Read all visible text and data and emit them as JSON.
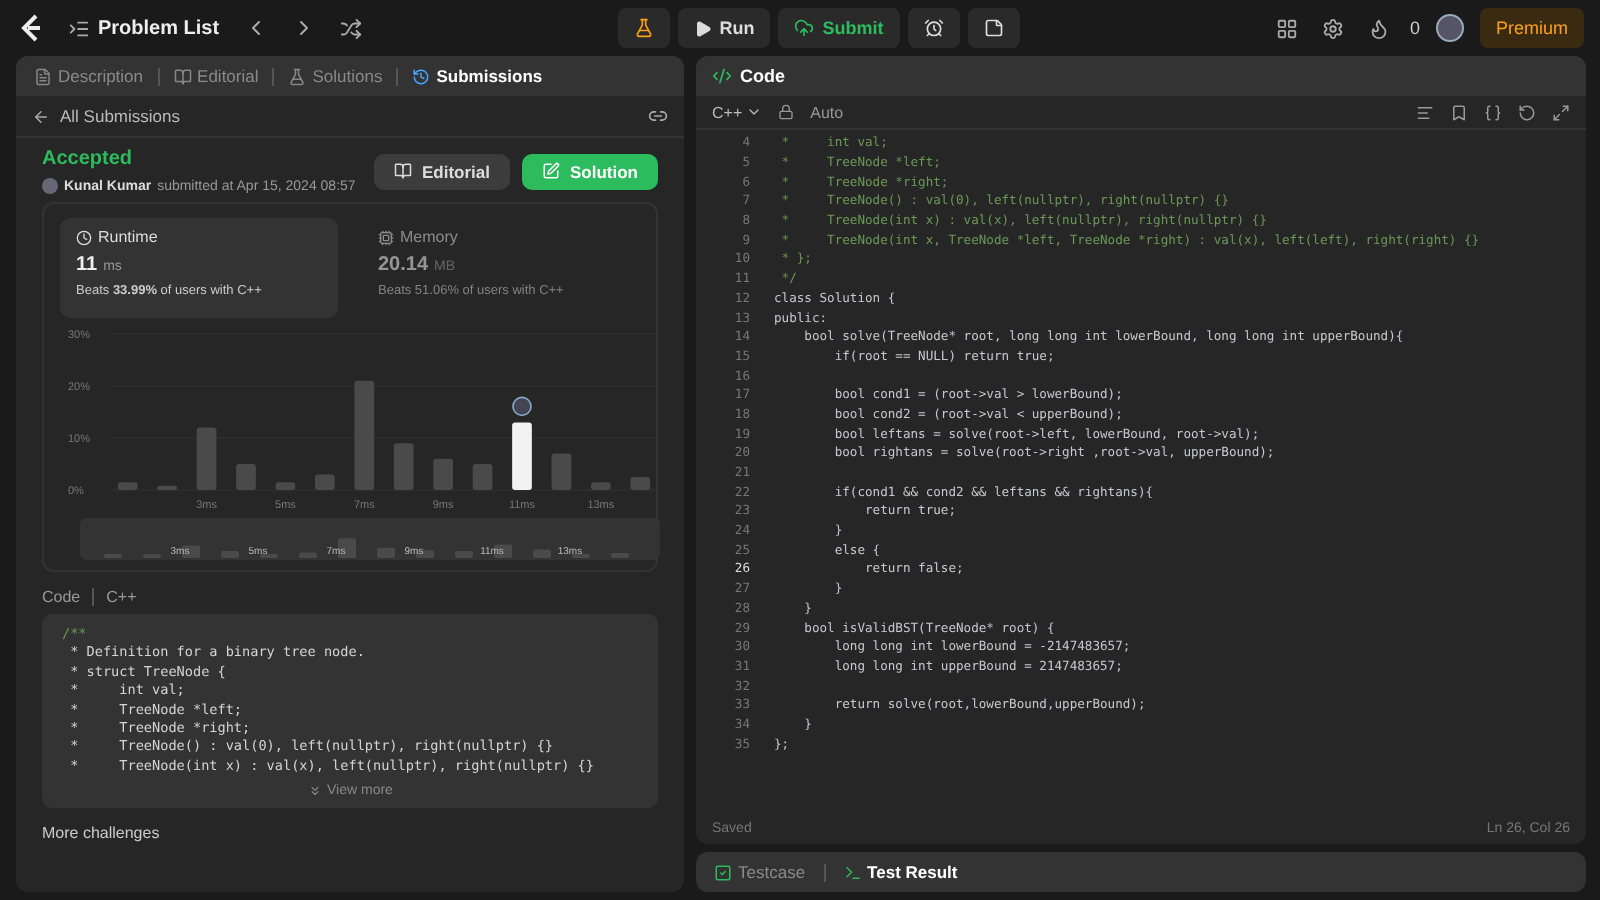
{
  "topbar": {
    "problem_list": "Problem List",
    "run": "Run",
    "submit": "Submit",
    "streak": "0",
    "premium": "Premium"
  },
  "left_tabs": [
    {
      "label": "Description",
      "selected": false
    },
    {
      "label": "Editorial",
      "selected": false
    },
    {
      "label": "Solutions",
      "selected": false
    },
    {
      "label": "Submissions",
      "selected": true
    }
  ],
  "back_link": "All Submissions",
  "submission": {
    "status": "Accepted",
    "user": "Kunal Kumar",
    "submitted": "submitted at Apr 15, 2024 08:57",
    "editorial_button": "Editorial",
    "solution_button": "Solution"
  },
  "stats": [
    {
      "title": "Runtime",
      "value": "11",
      "unit": "ms",
      "beats": "Beats **33.99%** of users with C++",
      "selected": true
    },
    {
      "title": "Memory",
      "value": "20.14",
      "unit": "MB",
      "beats": "Beats 51.06% of users with C++",
      "selected": false
    }
  ],
  "chart_data": {
    "type": "bar",
    "x": [
      1,
      2,
      3,
      4,
      5,
      6,
      7,
      8,
      9,
      10,
      11,
      12,
      13,
      14
    ],
    "stacked": true,
    "xlim": [
      0.5,
      14.5
    ],
    "series": [
      {
        "color": "#4a4a4a",
        "values": [
          1.5,
          0.8,
          12,
          5,
          1.5,
          3,
          21,
          9,
          6,
          5,
          null,
          7,
          1.5,
          2.5
        ]
      },
      {
        "color": "#f2f2f2",
        "values": [
          null,
          null,
          null,
          null,
          null,
          null,
          null,
          null,
          null,
          null,
          13,
          null,
          null,
          null
        ]
      }
    ],
    "ylim": [
      0,
      30
    ],
    "yticks": [
      {
        "value": 0,
        "label": "0%"
      },
      {
        "value": 10,
        "label": "10%"
      },
      {
        "value": 20,
        "label": "20%"
      },
      {
        "value": 30,
        "label": "30%"
      }
    ],
    "xticks": [
      {
        "value": 3,
        "label": "3ms"
      },
      {
        "value": 5,
        "label": "5ms"
      },
      {
        "value": 7,
        "label": "7ms"
      },
      {
        "value": 9,
        "label": "9ms"
      },
      {
        "value": 11,
        "label": "11ms"
      },
      {
        "value": 13,
        "label": "13ms"
      }
    ]
  },
  "overview_labels": [
    "3ms",
    "5ms",
    "7ms",
    "9ms",
    "11ms",
    "13ms"
  ],
  "code_header": {
    "title": "Code",
    "language": "C++"
  },
  "code_preview": [
    "/**",
    " * Definition for a binary tree node.",
    " * struct TreeNode {",
    " *     int val;",
    " *     TreeNode *left;",
    " *     TreeNode *right;",
    " *     TreeNode() : val(0), left(nullptr), right(nullptr) {}",
    " *     TreeNode(int x) : val(x), left(nullptr), right(nullptr) {}"
  ],
  "view_more": "View more",
  "more_challenges": "More challenges",
  "editor": {
    "title": "Code",
    "language": "C++",
    "mode": "Auto",
    "saved": "Saved",
    "position": "Ln 26, Col 26",
    "lines": [
      {
        "n": "4",
        "text": " *     int val;",
        "kind": "comment",
        "selected": false
      },
      {
        "n": "5",
        "text": " *     TreeNode *left;",
        "kind": "comment",
        "selected": false
      },
      {
        "n": "6",
        "text": " *     TreeNode *right;",
        "kind": "comment",
        "selected": false
      },
      {
        "n": "7",
        "text": " *     TreeNode() : val(0), left(nullptr), right(nullptr) {}",
        "kind": "comment",
        "selected": false
      },
      {
        "n": "8",
        "text": " *     TreeNode(int x) : val(x), left(nullptr), right(nullptr) {}",
        "kind": "comment",
        "selected": false
      },
      {
        "n": "9",
        "text": " *     TreeNode(int x, TreeNode *left, TreeNode *right) : val(x), left(left), right(right) {}",
        "kind": "comment",
        "selected": false
      },
      {
        "n": "10",
        "text": " * };",
        "kind": "comment",
        "selected": false
      },
      {
        "n": "11",
        "text": " */",
        "kind": "comment",
        "selected": false
      },
      {
        "n": "12",
        "text": "class Solution {",
        "kind": "code",
        "selected": false
      },
      {
        "n": "13",
        "text": "public:",
        "kind": "code",
        "selected": false
      },
      {
        "n": "14",
        "text": "    bool solve(TreeNode* root, long long int lowerBound, long long int upperBound){",
        "kind": "code",
        "selected": false
      },
      {
        "n": "15",
        "text": "        if(root == NULL) return true;",
        "kind": "code",
        "selected": false
      },
      {
        "n": "16",
        "kind": "blank",
        "selected": false
      },
      {
        "n": "17",
        "text": "        bool cond1 = (root->val > lowerBound);",
        "kind": "code",
        "selected": false
      },
      {
        "n": "18",
        "text": "        bool cond2 = (root->val < upperBound);",
        "kind": "code",
        "selected": false
      },
      {
        "n": "19",
        "text": "        bool leftans = solve(root->left, lowerBound, root->val);",
        "kind": "code",
        "selected": false
      },
      {
        "n": "20",
        "text": "        bool rightans = solve(root->right ,root->val, upperBound);",
        "kind": "code",
        "selected": false
      },
      {
        "n": "21",
        "kind": "blank",
        "selected": false
      },
      {
        "n": "22",
        "text": "        if(cond1 && cond2 && leftans && rightans){",
        "kind": "code",
        "selected": false
      },
      {
        "n": "23",
        "text": "            return true;",
        "kind": "code",
        "selected": false
      },
      {
        "n": "24",
        "text": "        }",
        "kind": "code",
        "selected": false
      },
      {
        "n": "25",
        "text": "        else {",
        "kind": "code",
        "selected": false
      },
      {
        "n": "26",
        "text": "            return false;",
        "kind": "code",
        "selected": true
      },
      {
        "n": "27",
        "text": "        }",
        "kind": "code",
        "selected": false
      },
      {
        "n": "28",
        "text": "    }",
        "kind": "code",
        "selected": false
      },
      {
        "n": "29",
        "text": "    bool isValidBST(TreeNode* root) {",
        "kind": "code",
        "selected": false
      },
      {
        "n": "30",
        "text": "        long long int lowerBound = -2147483657;",
        "kind": "code",
        "selected": false
      },
      {
        "n": "31",
        "text": "        long long int upperBound = 2147483657;",
        "kind": "code",
        "selected": false
      },
      {
        "n": "32",
        "kind": "blank",
        "selected": false
      },
      {
        "n": "33",
        "text": "        return solve(root,lowerBound,upperBound);",
        "kind": "code",
        "selected": false
      },
      {
        "n": "34",
        "text": "    }",
        "kind": "code",
        "selected": false
      },
      {
        "n": "35",
        "text": "};",
        "kind": "code",
        "selected": false
      }
    ]
  },
  "bottom_tabs": [
    {
      "label": "Testcase",
      "selected": false
    },
    {
      "label": "Test Result",
      "selected": true
    }
  ]
}
